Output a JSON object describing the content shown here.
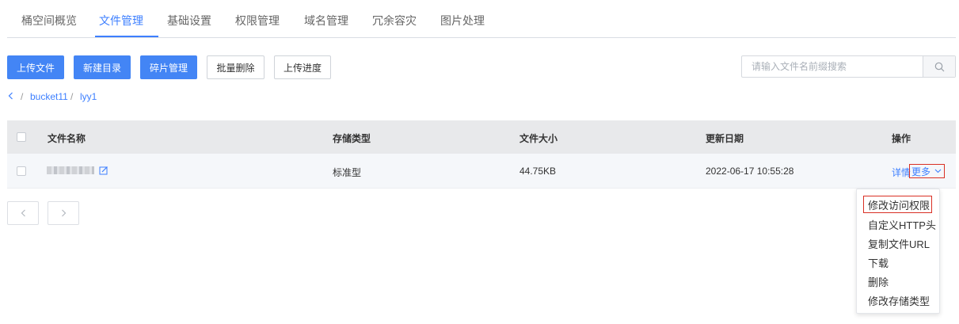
{
  "tabs": [
    {
      "label": "桶空间概览"
    },
    {
      "label": "文件管理"
    },
    {
      "label": "基础设置"
    },
    {
      "label": "权限管理"
    },
    {
      "label": "域名管理"
    },
    {
      "label": "冗余容灾"
    },
    {
      "label": "图片处理"
    }
  ],
  "active_tab": "文件管理",
  "toolbar": {
    "upload_label": "上传文件",
    "new_dir_label": "新建目录",
    "fragment_label": "碎片管理",
    "batch_delete_label": "批量删除",
    "upload_progress_label": "上传进度"
  },
  "search": {
    "placeholder": "请输入文件名前缀搜索",
    "value": ""
  },
  "breadcrumb": {
    "items": [
      "bucket11",
      "lyy1"
    ],
    "separator": "/"
  },
  "table": {
    "headers": [
      "文件名称",
      "存储类型",
      "文件大小",
      "更新日期",
      "操作"
    ],
    "rows": [
      {
        "storage": "标准型",
        "size": "44.75KB",
        "date": "2022-06-17 10:55:28"
      }
    ],
    "action_detail": "详情",
    "action_more": "更多"
  },
  "more_menu": {
    "items": [
      "修改访问权限",
      "自定义HTTP头",
      "复制文件URL",
      "下载",
      "删除",
      "修改存储类型"
    ],
    "highlighted": "修改访问权限"
  },
  "colors": {
    "primary": "#4385f5",
    "link": "#3d7fff",
    "highlight_border": "#d93025",
    "header_bg": "#e8e9eb"
  },
  "icons": {
    "search": "search-icon",
    "edit": "edit-icon",
    "back": "chevron-left-icon",
    "dropdown": "chevron-down-icon",
    "prev": "chevron-left-icon",
    "next": "chevron-right-icon"
  }
}
